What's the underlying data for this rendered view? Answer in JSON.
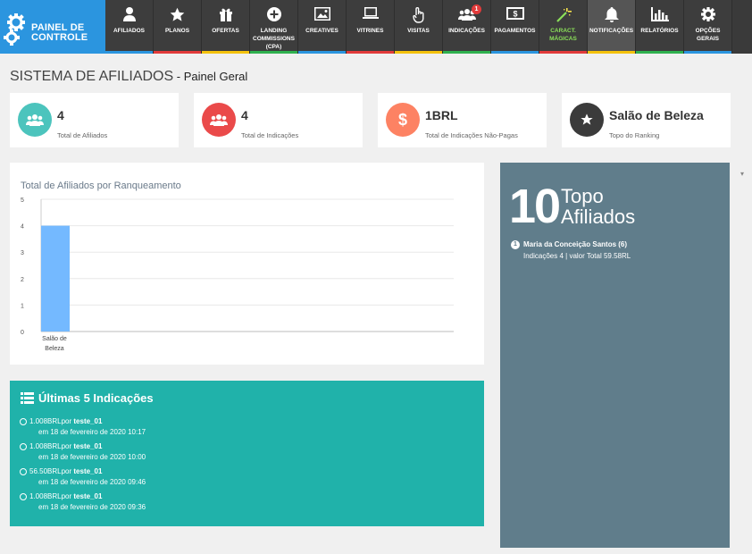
{
  "brand": {
    "line1": "PAINEL DE",
    "line2": "CONTROLE"
  },
  "nav": [
    {
      "label": "AFILIADOS",
      "icon": "user-icon",
      "stripe": "#3a3a3a"
    },
    {
      "label": "PLANOS",
      "icon": "star-icon",
      "stripe": "#3a3a3a"
    },
    {
      "label": "OFERTAS",
      "icon": "gift-icon",
      "stripe": "#3a3a3a"
    },
    {
      "label": "LANDING COMMISSIONS (CPA)",
      "icon": "plus-circle-icon",
      "stripe": "#3a3a3a"
    },
    {
      "label": "CREATIVES",
      "icon": "image-icon",
      "stripe": "#3a3a3a"
    },
    {
      "label": "VITRINES",
      "icon": "laptop-icon",
      "stripe": "#3a3a3a"
    },
    {
      "label": "VISITAS",
      "icon": "pointer-icon",
      "stripe": "#3a3a3a"
    },
    {
      "label": "INDICAÇÕES",
      "icon": "users-icon",
      "stripe": "#3a3a3a",
      "badge": "1"
    },
    {
      "label": "PAGAMENTOS",
      "icon": "money-icon",
      "stripe": "#3a3a3a"
    },
    {
      "label": "CARACT. MÁGICAS",
      "icon": "magic-wand-icon",
      "stripe": "#3a3a3a"
    },
    {
      "label": "NOTIFICAÇÕES",
      "icon": "bell-icon",
      "stripe": "#3a3a3a"
    },
    {
      "label": "RELATÓRIOS",
      "icon": "bar-chart-icon",
      "stripe": "#3a3a3a"
    },
    {
      "label": "OPÇÕES GERAIS",
      "icon": "gear-icon",
      "stripe": "#3a3a3a"
    }
  ],
  "stripe_colors": [
    "#2b95df",
    "#e23b3b",
    "#f4c20d",
    "#2fb14f"
  ],
  "page": {
    "title": "SISTEMA DE AFILIADOS",
    "separator": " - ",
    "subtitle": "Painel Geral"
  },
  "stats": [
    {
      "value": "4",
      "caption": "Total de Afiliados",
      "color": "#4cc4bd",
      "icon": "users-icon"
    },
    {
      "value": "4",
      "caption": "Total de Indicações",
      "color": "#ea4a4a",
      "icon": "users-icon"
    },
    {
      "value": "1BRL",
      "caption": "Total de Indicações Não-Pagas",
      "color": "#fd8263",
      "icon": "dollar-icon"
    },
    {
      "value": "Salão de Beleza",
      "caption": "Topo do Ranking",
      "color": "#3b3b3b",
      "icon": "star-icon"
    }
  ],
  "chart_data": {
    "type": "bar",
    "title": "Total de Afiliados por Ranqueamento",
    "categories": [
      "Salão de Beleza"
    ],
    "values": [
      4
    ],
    "ylim": [
      0,
      5
    ],
    "yticks": [
      "0",
      "1",
      "2",
      "3",
      "4",
      "5"
    ],
    "bar_color": "#74b9ff"
  },
  "last5": {
    "title": "Últimas 5 Indicações",
    "items": [
      {
        "amount": "1.008BRL",
        "by": "por",
        "user": "teste_01",
        "date": "em 18 de fevereiro de 2020 10:17"
      },
      {
        "amount": "1.008BRL",
        "by": "por",
        "user": "teste_01",
        "date": "em 18 de fevereiro de 2020 10:00"
      },
      {
        "amount": "56.50BRL",
        "by": "por",
        "user": "teste_01",
        "date": "em 18 de fevereiro de 2020 09:46"
      },
      {
        "amount": "1.008BRL",
        "by": "por",
        "user": "teste_01",
        "date": "em 18 de fevereiro de 2020 09:36"
      }
    ]
  },
  "top10": {
    "number": "10",
    "label1": "Topo",
    "label2": "Afiliados",
    "items": [
      {
        "rank": "1",
        "name": "Maria da Conceição Santos (6)",
        "detail": "Indicações 4 | valor Total 59.58RL"
      }
    ]
  }
}
